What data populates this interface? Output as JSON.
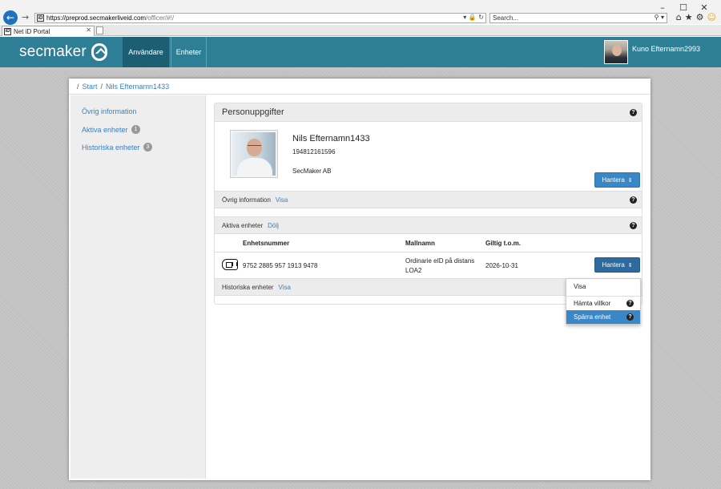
{
  "browser": {
    "url_host": "https://preprod.secmakerliveid.com",
    "url_path": "/officer/#!/",
    "search_placeholder": "Search...",
    "tab_title": "Net iD Portal",
    "tab_favicon": "iD",
    "window_buttons": [
      "–",
      "☐",
      "✕"
    ],
    "icons": [
      "home-icon",
      "favorites-star-icon",
      "settings-gear-icon",
      "feedback-smiley-icon"
    ]
  },
  "header": {
    "logo_text": "secmaker",
    "nav": [
      {
        "label": "Användare",
        "active": true
      },
      {
        "label": "Enheter",
        "active": false
      }
    ],
    "user_name": "Kuno Efternamn2993",
    "color_bar": "#2e7f96",
    "color_active_tab": "#1d5f72"
  },
  "breadcrumb": {
    "separator": "/",
    "items": [
      "Start",
      "Nils Efternamn1433"
    ]
  },
  "sidebar": {
    "items": [
      {
        "label": "Övrig information",
        "badge": ""
      },
      {
        "label": "Aktiva enheter",
        "badge": "1"
      },
      {
        "label": "Historiska enheter",
        "badge": "3"
      }
    ]
  },
  "person": {
    "section_title": "Personuppgifter",
    "name": "Nils Efternamn1433",
    "personal_number": "194812161596",
    "organization": "SecMaker AB",
    "manage_button": "Hantera"
  },
  "other_info": {
    "title": "Övrig information",
    "toggle": "Visa"
  },
  "active_units": {
    "title": "Aktiva enheter",
    "toggle": "Dölj",
    "columns": [
      "Enhetsnummer",
      "Mallnamn",
      "Giltig t.o.m."
    ],
    "rows": [
      {
        "number": "9752 2885 957 1913 9478",
        "template_line1": "Ordinarie eID på distans",
        "template_line2": "LOA2",
        "valid_until": "2026-10-31",
        "button": "Hantera"
      }
    ]
  },
  "history_units": {
    "title": "Historiska enheter",
    "toggle": "Visa"
  },
  "dropdown": {
    "items": [
      {
        "label": "Visa",
        "help": false,
        "selected": false
      },
      {
        "label": "Hämta villkor",
        "help": true,
        "selected": false
      },
      {
        "label": "Spärra enhet",
        "help": true,
        "selected": true
      }
    ],
    "help_glyph": "?"
  }
}
